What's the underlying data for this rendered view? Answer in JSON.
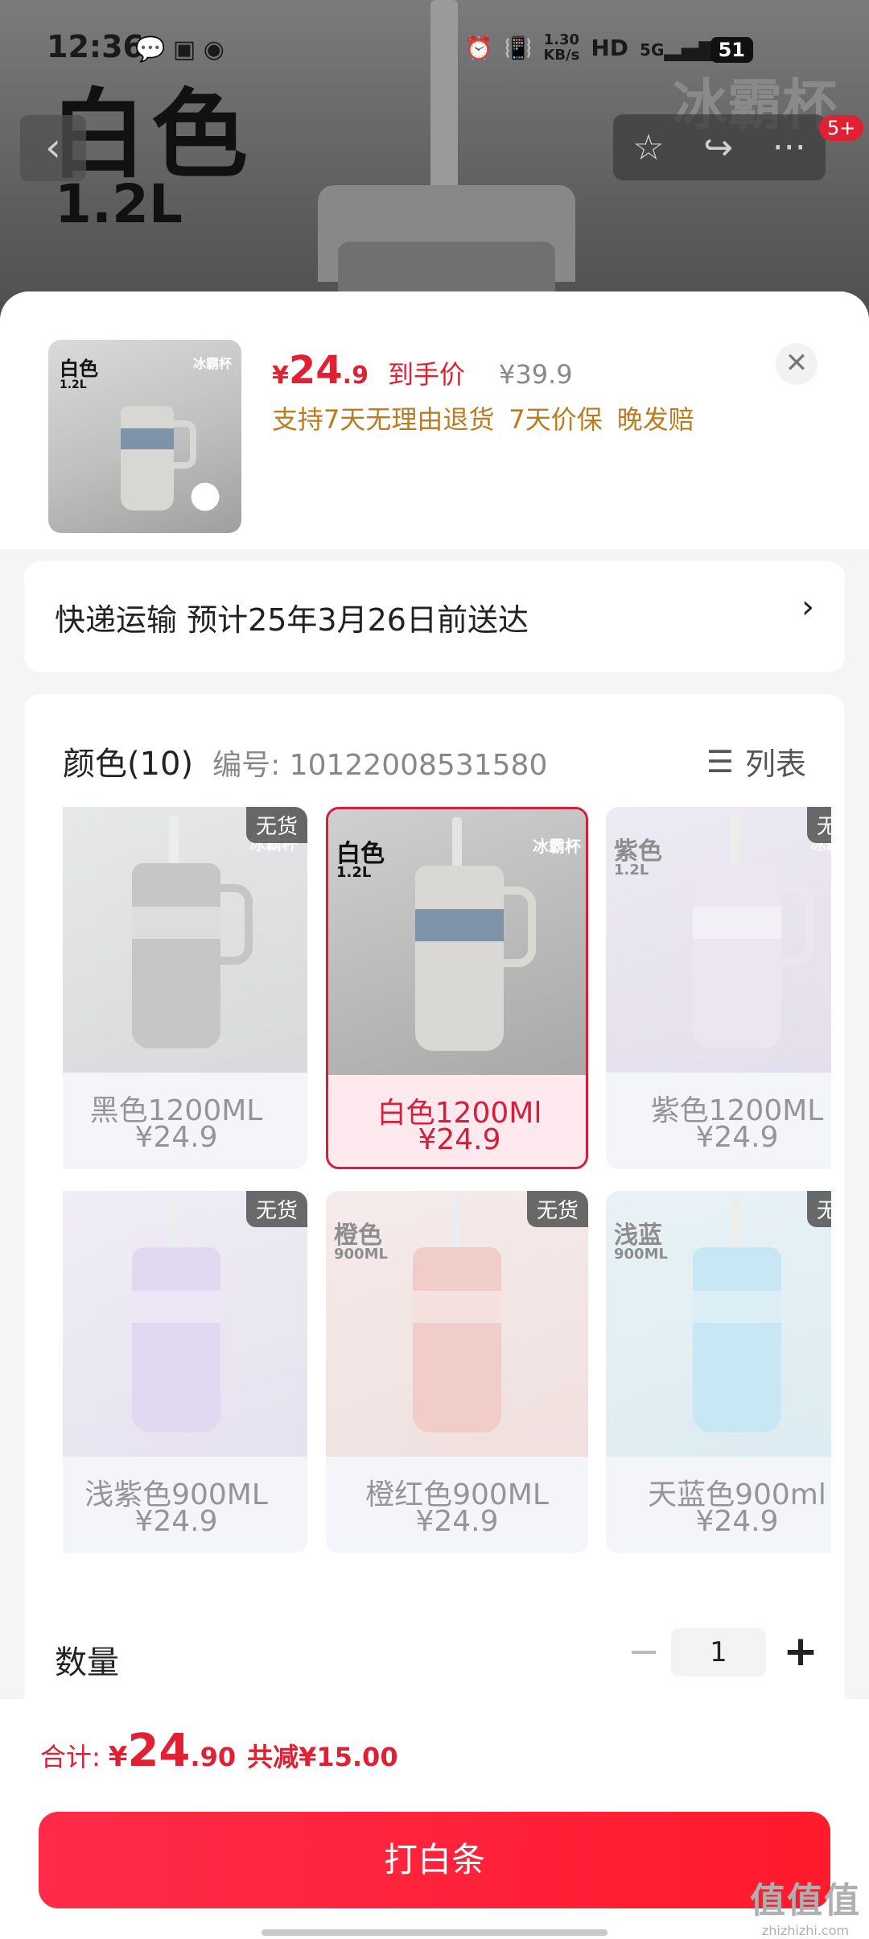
{
  "status_bar": {
    "time": "12:36",
    "net_speed_value": "1.30",
    "net_speed_unit": "KB/s",
    "hd": "HD",
    "network": "5G",
    "battery": "51"
  },
  "hero": {
    "color_text": "白色",
    "capacity_text": "1.2L",
    "brand_text": "冰霸杯",
    "badge": "5+"
  },
  "product": {
    "thumb_color": "白色",
    "thumb_capacity": "1.2L",
    "thumb_brand": "冰霸杯",
    "price_currency": "¥",
    "price_int": "24",
    "price_dec": ".9",
    "price_label": "到手价",
    "original_price": "¥39.9",
    "promises": [
      "支持7天无理由退货",
      "7天价保",
      "晚发赔"
    ]
  },
  "shipping": {
    "text": "快递运输 预计25年3月26日前送达"
  },
  "options": {
    "label": "颜色(10)",
    "code": "编号: 10122008531580",
    "view_label": "列表",
    "out_of_stock": "无货",
    "items": [
      {
        "name": "黑色1200ML",
        "price": "¥24.9",
        "color": "",
        "cap": "",
        "brand": "冰霸杯",
        "selected": false,
        "oos": true
      },
      {
        "name": "白色1200Ml",
        "price": "¥24.9",
        "color": "白色",
        "cap": "1.2L",
        "brand": "冰霸杯",
        "selected": true,
        "oos": false
      },
      {
        "name": "紫色1200ML",
        "price": "¥24.9",
        "color": "紫色",
        "cap": "1.2L",
        "brand": "冰霸杯",
        "selected": false,
        "oos": true
      },
      {
        "name": "浅紫色900ML",
        "price": "¥24.9",
        "color": "",
        "cap": "",
        "brand": "",
        "selected": false,
        "oos": true
      },
      {
        "name": "橙红色900ML",
        "price": "¥24.9",
        "color": "橙色",
        "cap": "900ML",
        "brand": "",
        "selected": false,
        "oos": true
      },
      {
        "name": "天蓝色900ml",
        "price": "¥24.9",
        "color": "浅蓝",
        "cap": "900ML",
        "brand": "",
        "selected": false,
        "oos": true
      }
    ]
  },
  "quantity": {
    "label": "数量",
    "value": "1"
  },
  "footer": {
    "total_label": "合计:",
    "total_currency": "¥",
    "total_int": "24",
    "total_dec": ".90",
    "saving": "共减¥15.00",
    "button": "打白条"
  },
  "watermark": {
    "main": "值值值",
    "site": "zhizhizhi.com"
  },
  "colors": {
    "accent": "#e02033",
    "gold": "#b97c21"
  }
}
